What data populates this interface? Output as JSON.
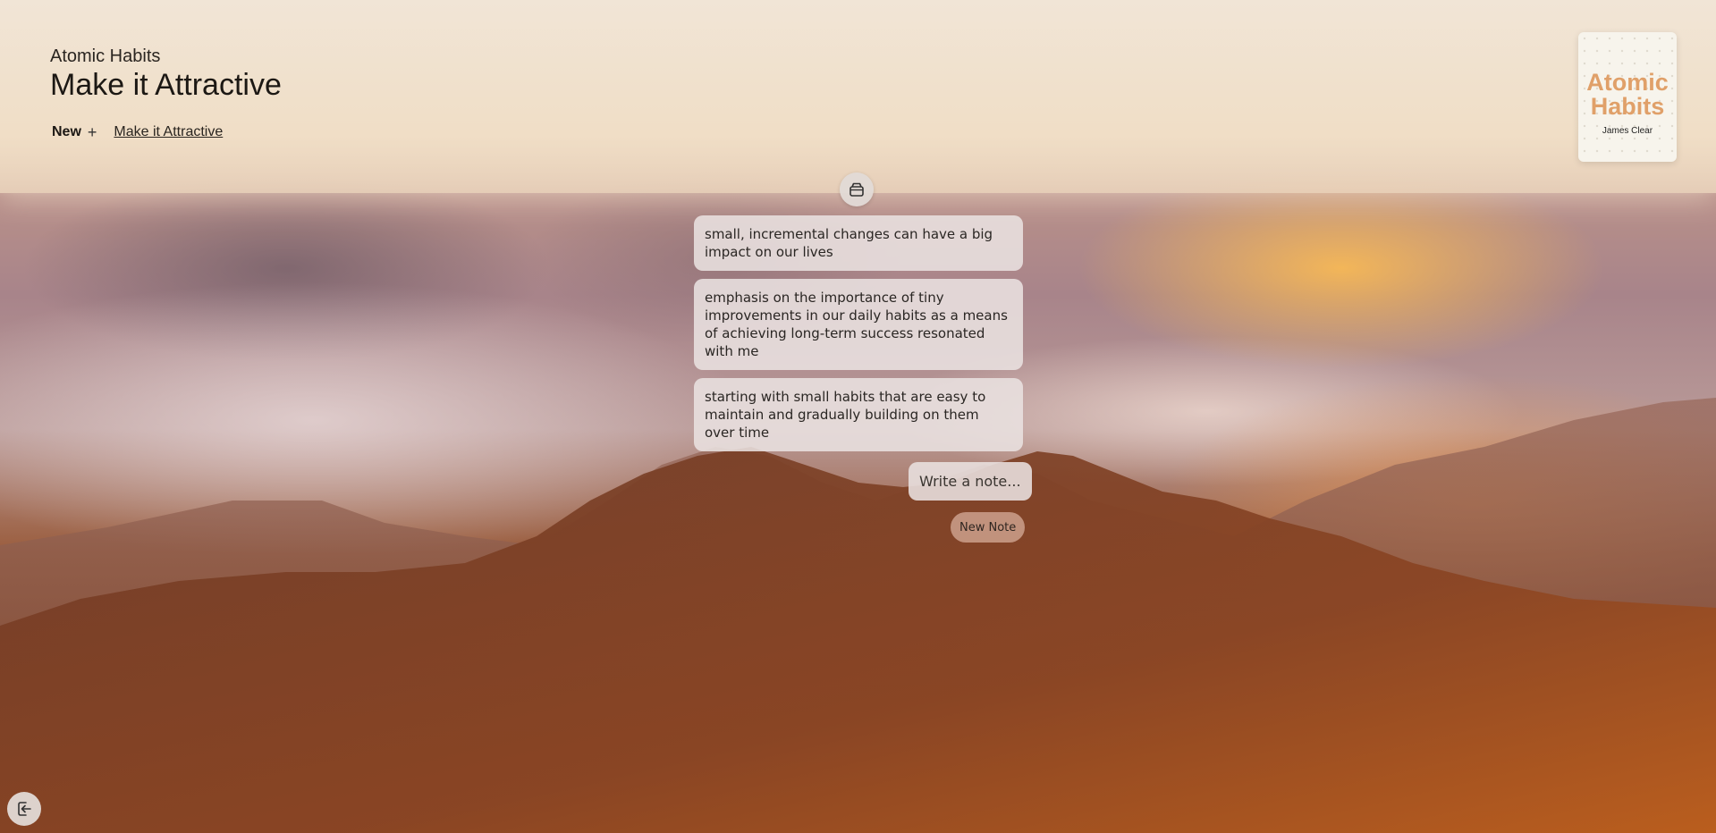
{
  "header": {
    "book_title": "Atomic Habits",
    "chapter_title": "Make it Attractive",
    "new_label": "New",
    "plus_glyph": "+",
    "chapter_link": "Make it Attractive"
  },
  "book_cover": {
    "title_line1": "Atomic",
    "title_line2": "Habits",
    "author": "James Clear",
    "title_color": "#e0a069"
  },
  "toolbar": {
    "archive_icon": "archive-icon"
  },
  "notes": [
    {
      "text": "small, incremental changes can have a big impact on our lives"
    },
    {
      "text": "emphasis on the importance of tiny improvements in our daily habits as a means of achieving long-term success resonated with me"
    },
    {
      "text": "starting with small habits that are easy to maintain and gradually building on them over time"
    }
  ],
  "composer": {
    "placeholder": "Write a note...",
    "new_note_label": "New Note"
  },
  "footer": {
    "logout_icon": "logout-icon"
  }
}
